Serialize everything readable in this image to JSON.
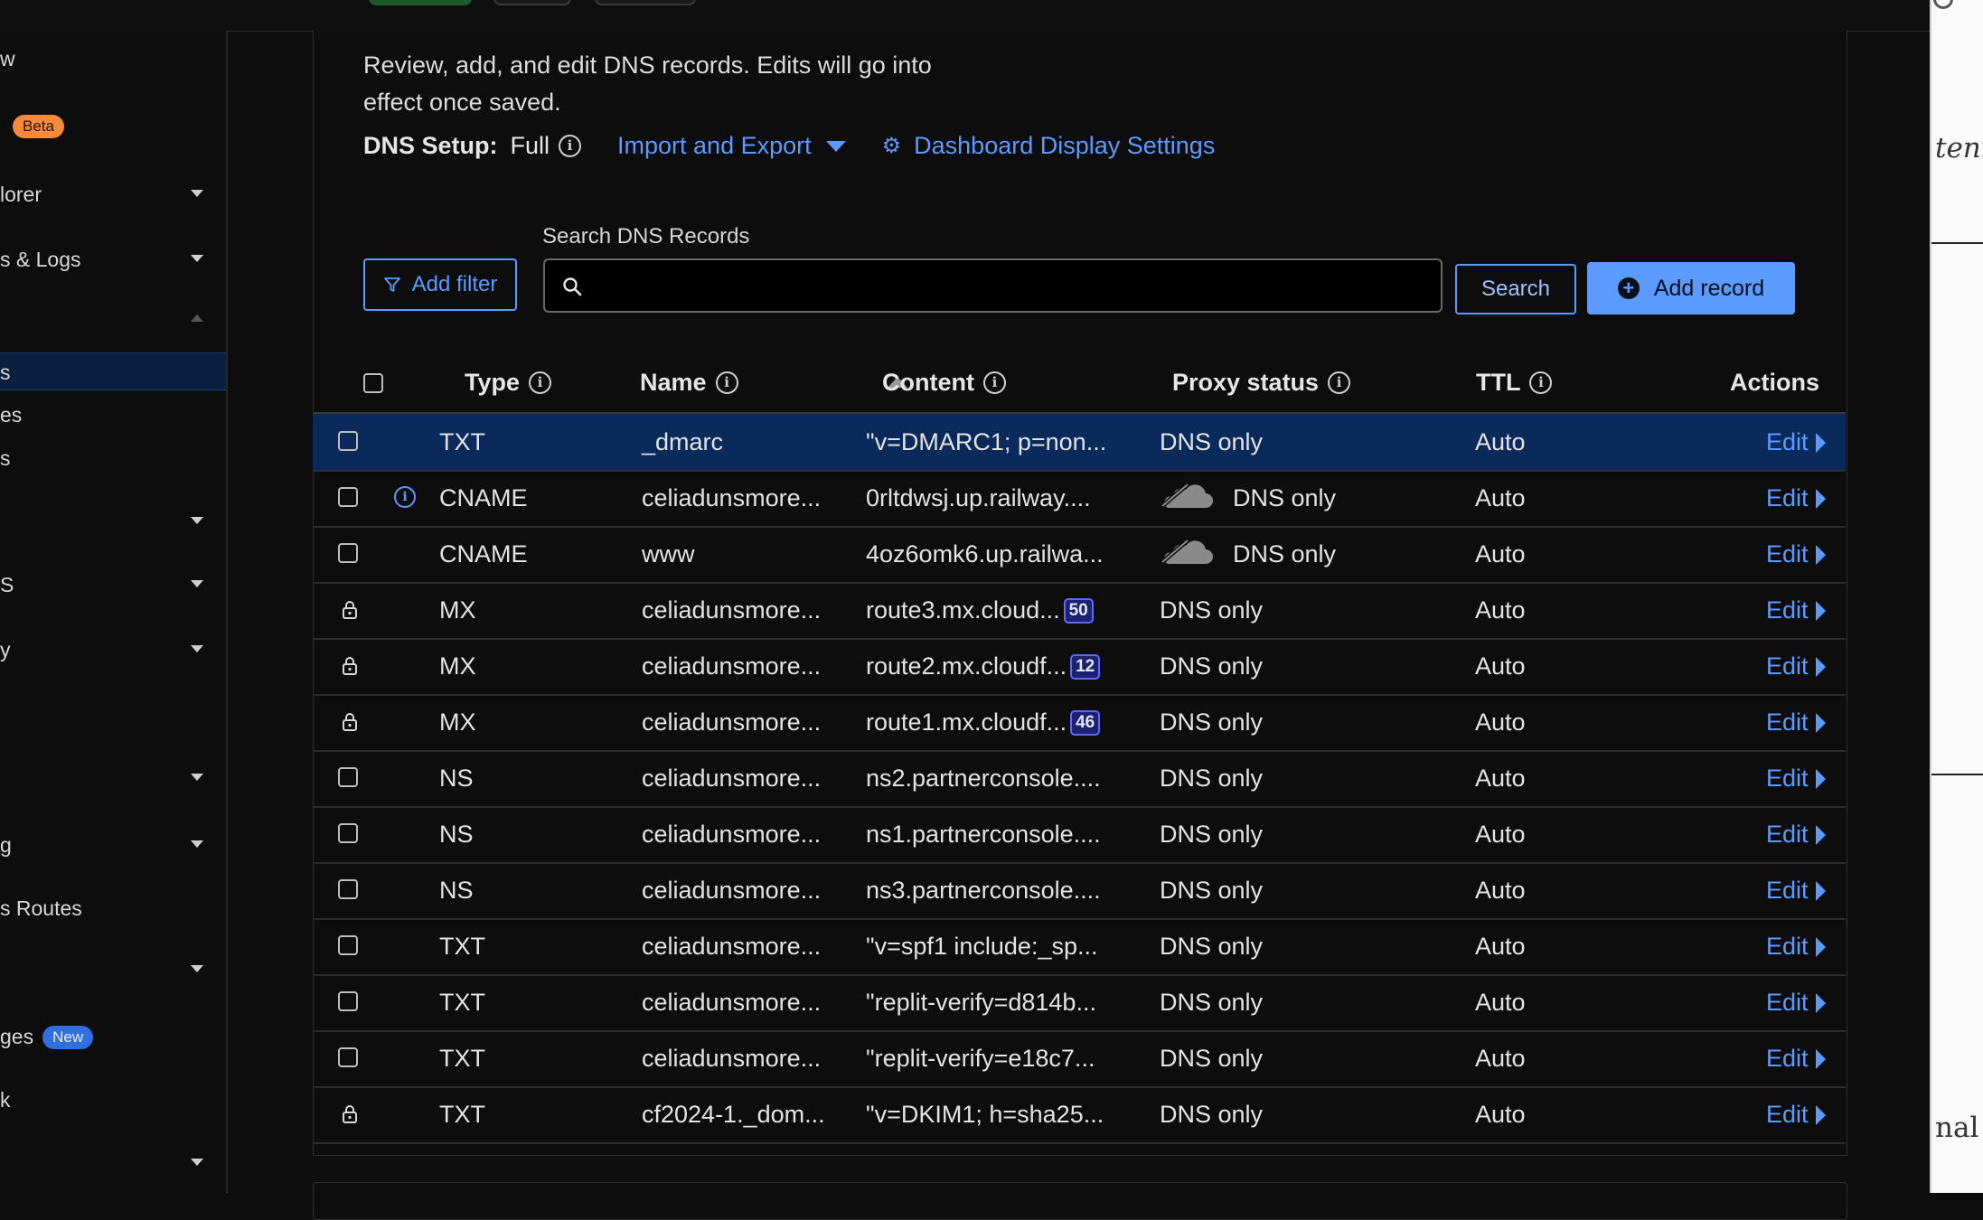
{
  "sidebar": {
    "items": [
      {
        "label": "w",
        "caret": "none"
      },
      {
        "label": "",
        "badge": "Beta",
        "caret": "none"
      },
      {
        "label": "lorer",
        "caret": "down"
      },
      {
        "label": "s & Logs",
        "caret": "down"
      },
      {
        "label": "",
        "caret": "up"
      },
      {
        "label": "s",
        "caret": "none",
        "active": true
      },
      {
        "label": "es",
        "caret": "none"
      },
      {
        "label": "s",
        "caret": "none"
      },
      {
        "label": "",
        "caret": "down"
      },
      {
        "label": "S",
        "caret": "down"
      },
      {
        "label": "y",
        "caret": "down"
      },
      {
        "label": "",
        "caret": "down"
      },
      {
        "label": "g",
        "caret": "down"
      },
      {
        "label": "s Routes",
        "caret": "none"
      },
      {
        "label": "",
        "caret": "down"
      },
      {
        "label": "ges",
        "badge": "New",
        "caret": "none"
      },
      {
        "label": "k",
        "caret": "none"
      },
      {
        "label": "",
        "caret": "down"
      }
    ]
  },
  "header": {
    "description": "Review, add, and edit DNS records. Edits will go into effect once saved.",
    "setup_label": "DNS Setup:",
    "setup_value": "Full",
    "import_export": "Import and Export",
    "display_settings": "Dashboard Display Settings"
  },
  "toolbar": {
    "add_filter": "Add filter",
    "search_label": "Search DNS Records",
    "search_value": "",
    "search_placeholder": "",
    "search_button": "Search",
    "add_record": "Add record"
  },
  "table": {
    "columns": [
      "Type",
      "Name",
      "Content",
      "Proxy status",
      "TTL",
      "Actions"
    ],
    "rows": [
      {
        "type": "TXT",
        "name": "_dmarc",
        "content": "\"v=DMARC1; p=non...",
        "proxy": "DNS only",
        "ttl": "Auto",
        "action": "Edit",
        "lead": "checkbox",
        "selected": true
      },
      {
        "type": "CNAME",
        "name": "celiadunsmore...",
        "content": "0rltdwsj.up.railway....",
        "proxy": "DNS only",
        "ttl": "Auto",
        "action": "Edit",
        "lead": "checkbox",
        "info": true,
        "cloud": true
      },
      {
        "type": "CNAME",
        "name": "www",
        "content": "4oz6omk6.up.railwa...",
        "proxy": "DNS only",
        "ttl": "Auto",
        "action": "Edit",
        "lead": "checkbox",
        "cloud": true
      },
      {
        "type": "MX",
        "name": "celiadunsmore...",
        "content": "route3.mx.cloud...",
        "priority": "50",
        "proxy": "DNS only",
        "ttl": "Auto",
        "action": "Edit",
        "lead": "lock"
      },
      {
        "type": "MX",
        "name": "celiadunsmore...",
        "content": "route2.mx.cloudf...",
        "priority": "12",
        "proxy": "DNS only",
        "ttl": "Auto",
        "action": "Edit",
        "lead": "lock"
      },
      {
        "type": "MX",
        "name": "celiadunsmore...",
        "content": "route1.mx.cloudf...",
        "priority": "46",
        "proxy": "DNS only",
        "ttl": "Auto",
        "action": "Edit",
        "lead": "lock"
      },
      {
        "type": "NS",
        "name": "celiadunsmore...",
        "content": "ns2.partnerconsole....",
        "proxy": "DNS only",
        "ttl": "Auto",
        "action": "Edit",
        "lead": "checkbox"
      },
      {
        "type": "NS",
        "name": "celiadunsmore...",
        "content": "ns1.partnerconsole....",
        "proxy": "DNS only",
        "ttl": "Auto",
        "action": "Edit",
        "lead": "checkbox"
      },
      {
        "type": "NS",
        "name": "celiadunsmore...",
        "content": "ns3.partnerconsole....",
        "proxy": "DNS only",
        "ttl": "Auto",
        "action": "Edit",
        "lead": "checkbox"
      },
      {
        "type": "TXT",
        "name": "celiadunsmore...",
        "content": "\"v=spf1 include:_sp...",
        "proxy": "DNS only",
        "ttl": "Auto",
        "action": "Edit",
        "lead": "checkbox"
      },
      {
        "type": "TXT",
        "name": "celiadunsmore...",
        "content": "\"replit-verify=d814b...",
        "proxy": "DNS only",
        "ttl": "Auto",
        "action": "Edit",
        "lead": "checkbox"
      },
      {
        "type": "TXT",
        "name": "celiadunsmore...",
        "content": "\"replit-verify=e18c7...",
        "proxy": "DNS only",
        "ttl": "Auto",
        "action": "Edit",
        "lead": "checkbox"
      },
      {
        "type": "TXT",
        "name": "cf2024-1._dom...",
        "content": "\"v=DKIM1; h=sha25...",
        "proxy": "DNS only",
        "ttl": "Auto",
        "action": "Edit",
        "lead": "lock"
      }
    ]
  },
  "right_edge": {
    "text_top": "tent",
    "text_bottom": "nal"
  },
  "colors": {
    "accent": "#5b9bff",
    "selected_row": "#0b2a5c",
    "beta": "#f48a3a",
    "new": "#2f6fe0"
  }
}
